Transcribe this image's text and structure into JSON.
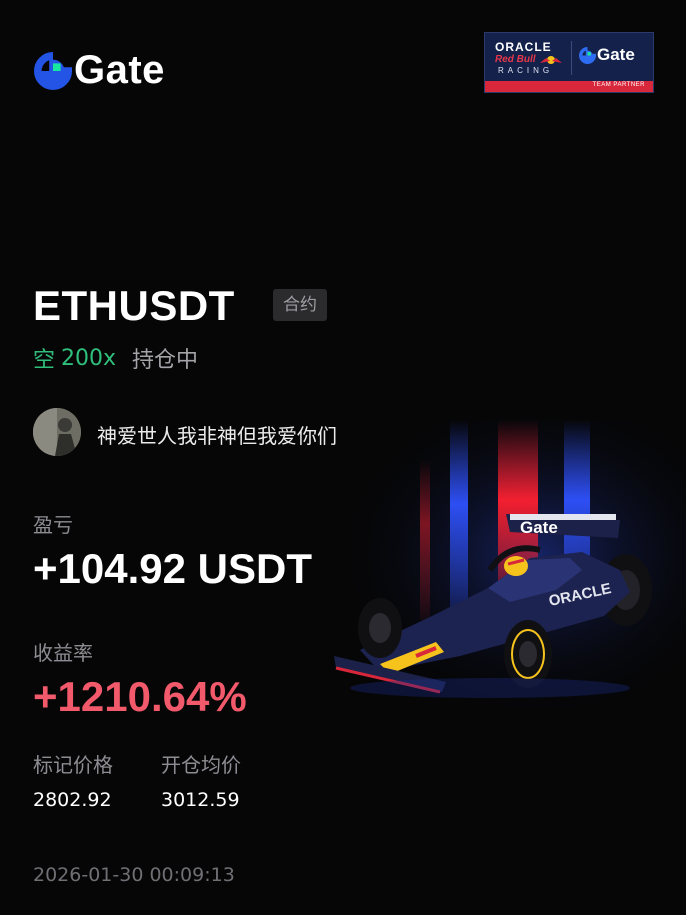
{
  "brand": {
    "name": "Gate"
  },
  "partner": {
    "oracle": "ORACLE",
    "redbull": "Red Bull",
    "racing": "RACING",
    "gate": "Gate",
    "team_partner": "TEAM PARTNER"
  },
  "position": {
    "pair": "ETHUSDT",
    "type": "合约",
    "direction": "空",
    "leverage": "200x",
    "status": "持仓中"
  },
  "user": {
    "name": "神爱世人我非神但我爱你们"
  },
  "stats": {
    "pnl_label": "盈亏",
    "pnl_value": "+104.92 USDT",
    "roi_label": "收益率",
    "roi_value": "+1210.64%",
    "mark_price_label": "标记价格",
    "mark_price_value": "2802.92",
    "entry_price_label": "开仓均价",
    "entry_price_value": "3012.59"
  },
  "timestamp": "2026-01-30 00:09:13",
  "car_livery": {
    "text": "Gate"
  },
  "colors": {
    "background": "#060607",
    "short_green": "#2fbf7b",
    "roi_red": "#f25a6c",
    "gate_blue": "#2354e6",
    "gate_teal": "#17e6a1",
    "racing_red": "#d8263a",
    "racing_navy": "#13214b"
  }
}
